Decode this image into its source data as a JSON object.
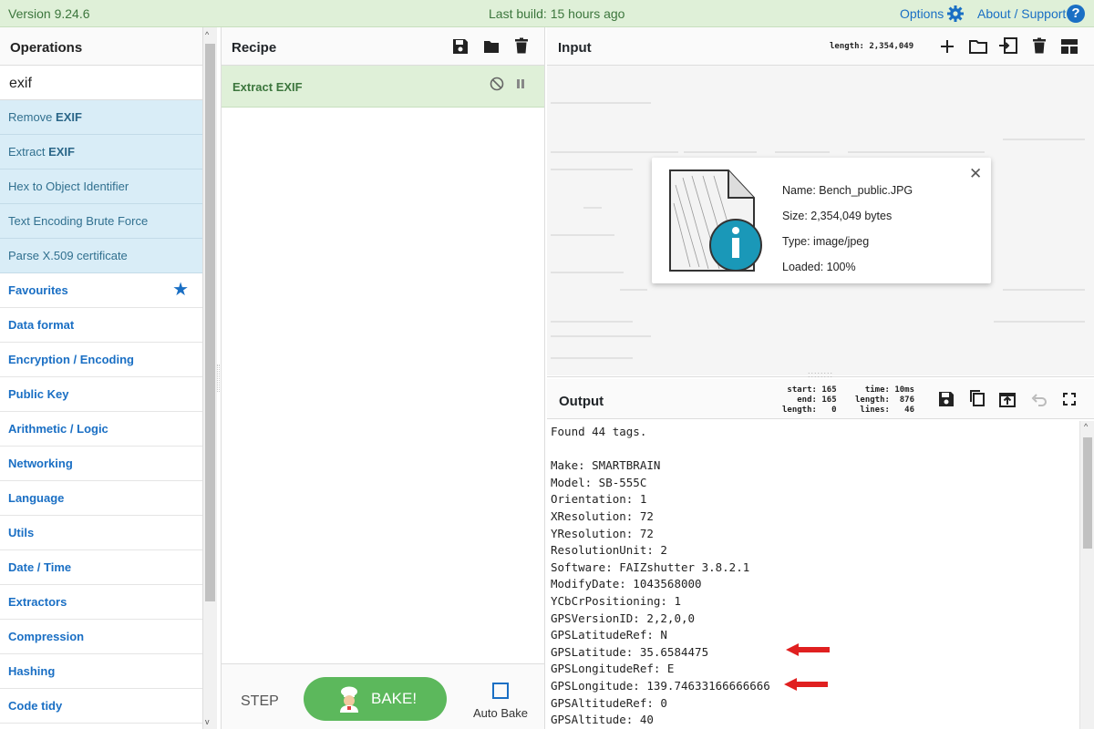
{
  "banner": {
    "version": "Version 9.24.6",
    "last_build": "Last build: 15 hours ago",
    "options": "Options",
    "about": "About / Support",
    "help": "?"
  },
  "operations": {
    "title": "Operations",
    "search_value": "exif",
    "results": [
      {
        "label_parts": [
          "Remove ",
          "EXIF"
        ]
      },
      {
        "label_parts": [
          "Extract ",
          "EXIF"
        ]
      },
      {
        "label": "Hex to Object Identifier"
      },
      {
        "label": "Text Encoding Brute Force"
      },
      {
        "label": "Parse X.509 certificate"
      }
    ],
    "categories": [
      "Favourites",
      "Data format",
      "Encryption / Encoding",
      "Public Key",
      "Arithmetic / Logic",
      "Networking",
      "Language",
      "Utils",
      "Date / Time",
      "Extractors",
      "Compression",
      "Hashing",
      "Code tidy"
    ]
  },
  "recipe": {
    "title": "Recipe",
    "operation": "Extract EXIF",
    "step": "STEP",
    "bake": "BAKE!",
    "auto_bake": "Auto Bake"
  },
  "input": {
    "title": "Input",
    "length": "length: 2,354,049"
  },
  "file": {
    "name": "Name: Bench_public.JPG",
    "size": "Size: 2,354,049 bytes",
    "type": "Type: image/jpeg",
    "loaded": "Loaded: 100%"
  },
  "output": {
    "title": "Output",
    "stats_pos": "start: 165\n  end: 165\nlength:   0",
    "stats_time": "  time: 10ms\nlength:  876\n lines:   46",
    "lines": [
      "Found 44 tags.",
      "",
      "Make: SMARTBRAIN",
      "Model: SB-555C",
      "Orientation: 1",
      "XResolution: 72",
      "YResolution: 72",
      "ResolutionUnit: 2",
      "Software: FAIZshutter 3.8.2.1",
      "ModifyDate: 1043568000",
      "YCbCrPositioning: 1",
      "GPSVersionID: 2,2,0,0",
      "GPSLatitudeRef: N",
      "GPSLatitude: 35.6584475",
      "GPSLongitudeRef: E",
      "GPSLongitude: 139.74633166666666",
      "GPSAltitudeRef: 0",
      "GPSAltitude: 40"
    ]
  },
  "colors": {
    "accent": "#1a6fc4",
    "banner_bg": "#dff0d8",
    "bake_green": "#5cb85c",
    "arrow_red": "#e02020"
  }
}
